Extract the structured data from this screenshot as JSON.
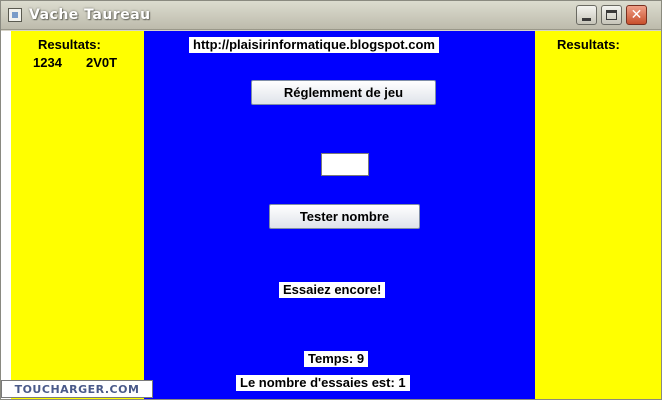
{
  "window": {
    "title": "Vache Taureau",
    "controls": {
      "close_glyph": "✕"
    }
  },
  "left_panel": {
    "header": "Resultats:",
    "rows": [
      {
        "guess": "1234",
        "result": "2V0T"
      }
    ]
  },
  "right_panel": {
    "header": "Resultats:"
  },
  "center": {
    "url": "http://plaisirinformatique.blogspot.com",
    "rules_button": "Réglemment de jeu",
    "number_input": {
      "value": ""
    },
    "test_button": "Tester nombre",
    "message": "Essaiez encore!",
    "timer": "Temps: 9",
    "attempts": "Le nombre d'essaies est: 1"
  },
  "watermark": "TOUCHARGER.COM",
  "colors": {
    "side_panels": "#ffff00",
    "center_panel": "#0000ff"
  }
}
